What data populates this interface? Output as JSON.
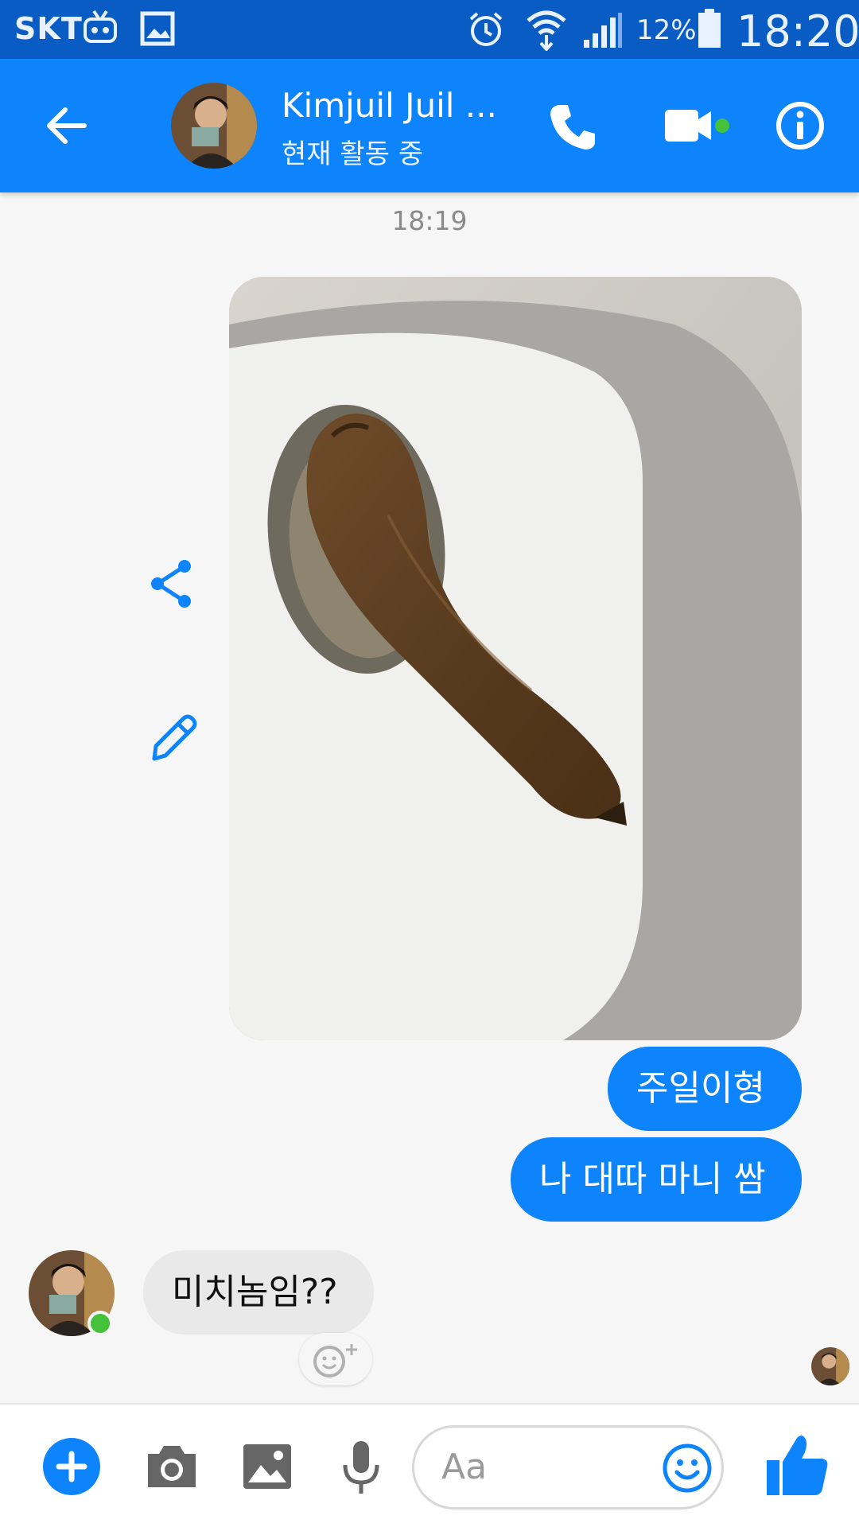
{
  "status_bar": {
    "carrier": "SKT",
    "battery_percent": "12%",
    "time": "18:20",
    "icons": [
      "tv-app-icon",
      "image-icon",
      "alarm-icon",
      "wifi-icon",
      "signal-icon",
      "battery-icon"
    ]
  },
  "header": {
    "contact_name": "Kimjuil Juil ...",
    "contact_status": "현재 활동 중",
    "active_indicator_color": "#45c13a",
    "buttons": [
      "back-arrow-icon",
      "phone-icon",
      "video-camera-icon",
      "info-icon"
    ]
  },
  "colors": {
    "brand_blue": "#0d84fb",
    "status_bar": "#0a5cc5",
    "incoming_bubble": "#e9e9ea",
    "background": "#f6f6f6"
  },
  "conversation": {
    "timestamp": "18:19",
    "photo_actions": [
      "share-icon",
      "edit-pencil-icon"
    ],
    "outgoing": [
      {
        "text": "주일이형"
      },
      {
        "text": "나 대따 마니 쌈"
      }
    ],
    "incoming": [
      {
        "text": "미치놈임??"
      }
    ]
  },
  "composer": {
    "placeholder": "Aa",
    "buttons": [
      "add-icon",
      "camera-icon",
      "gallery-icon",
      "microphone-icon",
      "emoji-icon",
      "thumbs-up-icon"
    ]
  }
}
